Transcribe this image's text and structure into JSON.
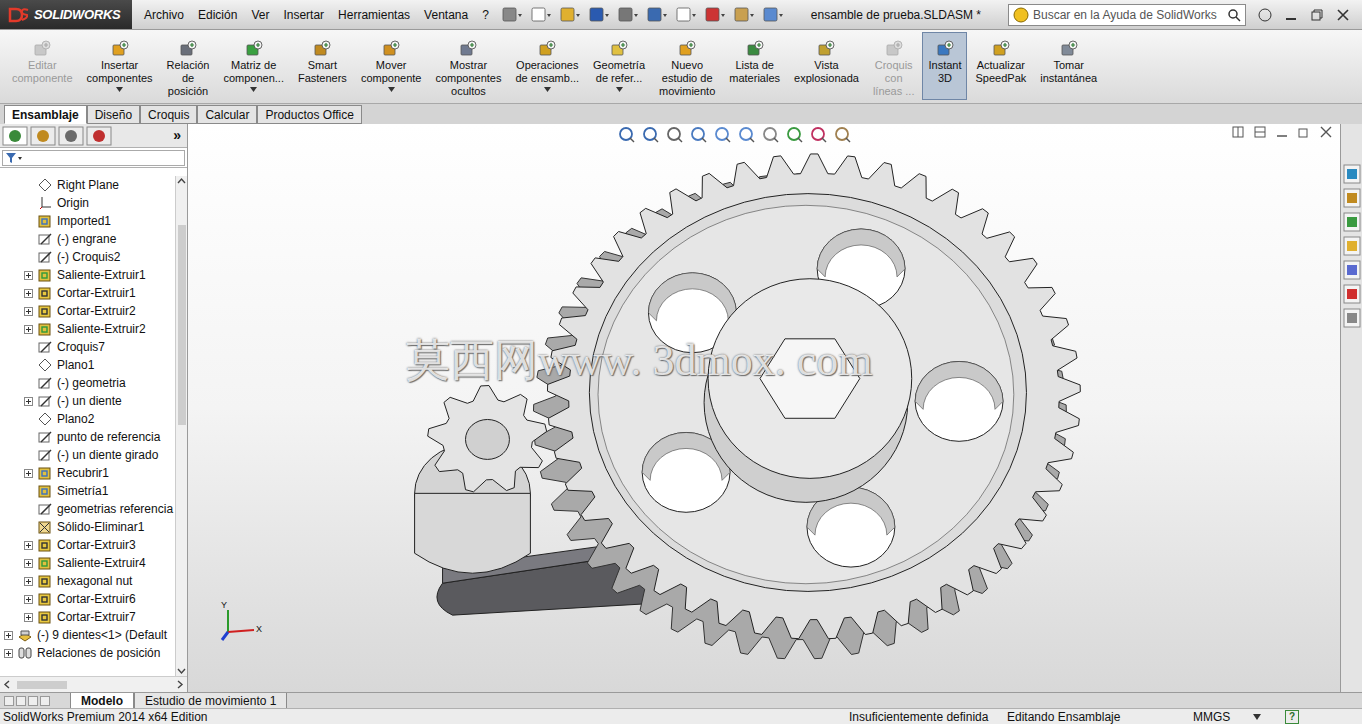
{
  "app": {
    "logo": "SOLIDWORKS",
    "document_title": "ensamble de prueba.SLDASM *"
  },
  "menu": [
    "Archivo",
    "Edición",
    "Ver",
    "Insertar",
    "Herramientas",
    "Ventana",
    "?"
  ],
  "search": {
    "placeholder": "Buscar en la Ayuda de SolidWorks"
  },
  "ribbon": [
    {
      "lines": [
        "Editar",
        "componente"
      ],
      "disabled": true,
      "selected": false,
      "dropdown": false
    },
    {
      "lines": [
        "Insertar",
        "componentes"
      ],
      "disabled": false,
      "selected": false,
      "dropdown": true
    },
    {
      "lines": [
        "Relación",
        "de",
        "posición"
      ],
      "disabled": false,
      "selected": false,
      "dropdown": false
    },
    {
      "lines": [
        "Matriz de",
        "componen..."
      ],
      "disabled": false,
      "selected": false,
      "dropdown": true
    },
    {
      "lines": [
        "Smart",
        "Fasteners"
      ],
      "disabled": false,
      "selected": false,
      "dropdown": false
    },
    {
      "lines": [
        "Mover",
        "componente"
      ],
      "disabled": false,
      "selected": false,
      "dropdown": true
    },
    {
      "lines": [
        "Mostrar",
        "componentes",
        "ocultos"
      ],
      "disabled": false,
      "selected": false,
      "dropdown": false
    },
    {
      "lines": [
        "Operaciones",
        "de ensamb..."
      ],
      "disabled": false,
      "selected": false,
      "dropdown": true
    },
    {
      "lines": [
        "Geometría",
        "de refer..."
      ],
      "disabled": false,
      "selected": false,
      "dropdown": true
    },
    {
      "lines": [
        "Nuevo",
        "estudio de",
        "movimiento"
      ],
      "disabled": false,
      "selected": false,
      "dropdown": false
    },
    {
      "lines": [
        "Lista de",
        "materiales"
      ],
      "disabled": false,
      "selected": false,
      "dropdown": false
    },
    {
      "lines": [
        "Vista",
        "explosionada"
      ],
      "disabled": false,
      "selected": false,
      "dropdown": false
    },
    {
      "lines": [
        "Croquis",
        "con",
        "líneas ..."
      ],
      "disabled": true,
      "selected": false,
      "dropdown": false
    },
    {
      "lines": [
        "Instant",
        "3D"
      ],
      "disabled": false,
      "selected": true,
      "dropdown": false
    },
    {
      "lines": [
        "Actualizar",
        "SpeedPak"
      ],
      "disabled": false,
      "selected": false,
      "dropdown": false
    },
    {
      "lines": [
        "Tomar",
        "instantánea"
      ],
      "disabled": false,
      "selected": false,
      "dropdown": false
    }
  ],
  "ribbon_tabs": [
    {
      "label": "Ensamblaje",
      "selected": true
    },
    {
      "label": "Diseño",
      "selected": false
    },
    {
      "label": "Croquis",
      "selected": false
    },
    {
      "label": "Calcular",
      "selected": false
    },
    {
      "label": "Productos Office",
      "selected": false
    }
  ],
  "panel": {
    "expand": "»"
  },
  "tree": [
    {
      "label": "Right Plane",
      "kind": "plane",
      "expandable": false,
      "child": true
    },
    {
      "label": "Origin",
      "kind": "origin",
      "expandable": false,
      "child": true
    },
    {
      "label": "Imported1",
      "kind": "imported",
      "expandable": false,
      "child": true
    },
    {
      "label": "(-) engrane",
      "kind": "sketch",
      "expandable": false,
      "child": true
    },
    {
      "label": "(-) Croquis2",
      "kind": "sketch",
      "expandable": false,
      "child": true
    },
    {
      "label": "Saliente-Extruir1",
      "kind": "boss",
      "expandable": true,
      "child": true
    },
    {
      "label": "Cortar-Extruir1",
      "kind": "cut",
      "expandable": true,
      "child": true
    },
    {
      "label": "Cortar-Extruir2",
      "kind": "cut",
      "expandable": true,
      "child": true
    },
    {
      "label": "Saliente-Extruir2",
      "kind": "boss",
      "expandable": true,
      "child": true
    },
    {
      "label": "Croquis7",
      "kind": "sketch",
      "expandable": false,
      "child": true
    },
    {
      "label": "Plano1",
      "kind": "plane",
      "expandable": false,
      "child": true
    },
    {
      "label": "(-) geometria",
      "kind": "sketch",
      "expandable": false,
      "child": true
    },
    {
      "label": "(-) un diente",
      "kind": "sketch",
      "expandable": true,
      "child": true
    },
    {
      "label": "Plano2",
      "kind": "plane",
      "expandable": false,
      "child": true
    },
    {
      "label": "punto de referencia",
      "kind": "sketch",
      "expandable": false,
      "child": true
    },
    {
      "label": "(-) un diente girado",
      "kind": "sketch",
      "expandable": false,
      "child": true
    },
    {
      "label": "Recubrir1",
      "kind": "loft",
      "expandable": true,
      "child": true
    },
    {
      "label": "Simetría1",
      "kind": "mirror",
      "expandable": false,
      "child": true
    },
    {
      "label": "geometrias referencia",
      "kind": "sketch",
      "expandable": false,
      "child": true
    },
    {
      "label": "Sólido-Eliminar1",
      "kind": "delete",
      "expandable": false,
      "child": true
    },
    {
      "label": "Cortar-Extruir3",
      "kind": "cut",
      "expandable": true,
      "child": true
    },
    {
      "label": "Saliente-Extruir4",
      "kind": "boss",
      "expandable": true,
      "child": true
    },
    {
      "label": "hexagonal nut",
      "kind": "cut",
      "expandable": true,
      "child": true
    },
    {
      "label": "Cortar-Extruir6",
      "kind": "cut",
      "expandable": true,
      "child": true
    },
    {
      "label": "Cortar-Extruir7",
      "kind": "cut",
      "expandable": true,
      "child": true
    },
    {
      "label": "(-) 9 dientes<1> (Default",
      "kind": "component",
      "expandable": true,
      "child": false
    },
    {
      "label": "Relaciones de posición",
      "kind": "mates",
      "expandable": true,
      "child": false
    }
  ],
  "watermark": "莫西网www. 3dmox. com",
  "triad": {
    "x": "X",
    "y": "Y"
  },
  "bottom_tabs": [
    {
      "label": "Modelo",
      "selected": true
    },
    {
      "label": "Estudio de movimiento 1",
      "selected": false
    }
  ],
  "status_bar": {
    "edition": "SolidWorks Premium 2014 x64 Edition",
    "state": "Insuficientemente definida",
    "mode": "Editando Ensamblaje",
    "units": "MMGS",
    "help": "?"
  }
}
